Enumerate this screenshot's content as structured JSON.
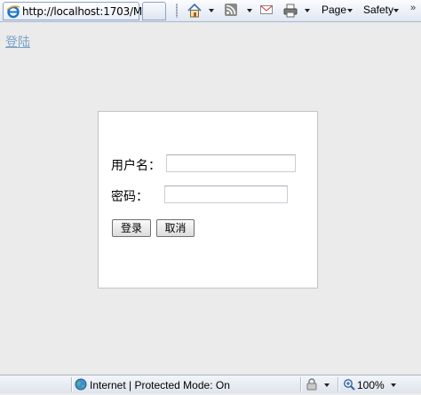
{
  "browser": {
    "tab_title": "http://localhost:1703/M...",
    "commands": {
      "page_label": "Page",
      "safety_label": "Safety"
    }
  },
  "page": {
    "login_link": "登陆",
    "form": {
      "username_label": "用户名：",
      "password_label": "密码：",
      "username_value": "",
      "password_value": "",
      "login_button": "登录",
      "cancel_button": "取消"
    }
  },
  "statusbar": {
    "zone_text": "Internet | Protected Mode: On",
    "zoom_text": "100%"
  },
  "colors": {
    "page_background": "#ebebeb",
    "link": "#7aa3c9"
  }
}
